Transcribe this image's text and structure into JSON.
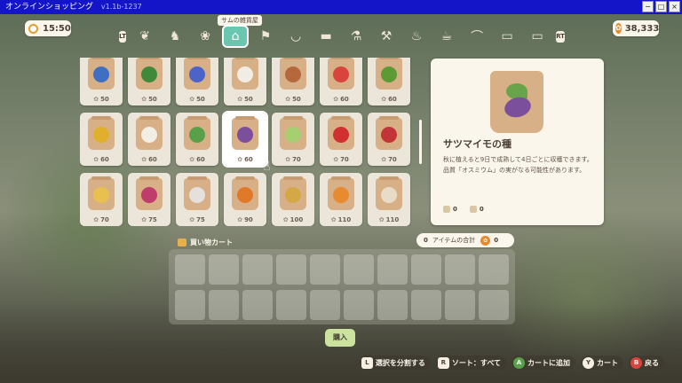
{
  "window": {
    "title": "オンラインショッピング",
    "version": "v1.1b-1237",
    "btn_min": "−",
    "btn_max": "□",
    "btn_close": "×"
  },
  "hud": {
    "time": "15:50",
    "money": "38,333"
  },
  "categories": {
    "lt": "LT",
    "rt": "RT",
    "tooltip": "サムの雑貨屋",
    "icons": [
      "feather-icon",
      "cat-icon",
      "seed-bag-icon",
      "shop-icon",
      "farm-icon",
      "bowl-icon",
      "anvil-icon",
      "flask-icon",
      "hammer-icon",
      "pot-icon",
      "cup-icon",
      "hanger-icon",
      "sofa-icon",
      "sofa2-icon"
    ],
    "active_index": 3
  },
  "products": [
    {
      "price": "50",
      "color": "#3f6fc2"
    },
    {
      "price": "50",
      "color": "#3f8a3a"
    },
    {
      "price": "50",
      "color": "#4c64c8"
    },
    {
      "price": "50",
      "color": "#f1ede4"
    },
    {
      "price": "50",
      "color": "#b4683c"
    },
    {
      "price": "60",
      "color": "#d9443c"
    },
    {
      "price": "60",
      "color": "#5b9a34"
    },
    {
      "price": "60",
      "color": "#e0b02c"
    },
    {
      "price": "60",
      "color": "#f2eee4"
    },
    {
      "price": "60",
      "color": "#5aa04a"
    },
    {
      "price": "60",
      "color": "#7c4f9c",
      "selected": true
    },
    {
      "price": "70",
      "color": "#a6d070"
    },
    {
      "price": "70",
      "color": "#d03030"
    },
    {
      "price": "70",
      "color": "#c23438"
    },
    {
      "price": "70",
      "color": "#e8c050"
    },
    {
      "price": "75",
      "color": "#c03c6c"
    },
    {
      "price": "75",
      "color": "#e4e0dc"
    },
    {
      "price": "90",
      "color": "#e07a28"
    },
    {
      "price": "100",
      "color": "#d4a844"
    },
    {
      "price": "110",
      "color": "#e88b30"
    },
    {
      "price": "110",
      "color": "#e8dcc8"
    }
  ],
  "detail": {
    "name": "サツマイモの種",
    "description": "秋に植えると9日で成熟して4日ごとに収穫できます。品質「オスミウム」の実がなる可能性があります。",
    "stat1": "0",
    "stat2": "0"
  },
  "cart": {
    "title": "買い物カート",
    "item_count": "0",
    "total_label": "アイテムの合計",
    "total_value": "0",
    "buy_label": "購入"
  },
  "hints": [
    {
      "key": "L",
      "label": "選択を分割する",
      "style": "sq"
    },
    {
      "key": "R",
      "label": "ソート：すべて",
      "style": "sq"
    },
    {
      "key": "A",
      "label": "カートに追加",
      "style": "gr"
    },
    {
      "key": "Y",
      "label": "カート",
      "style": "wh"
    },
    {
      "key": "B",
      "label": "戻る",
      "style": "rd"
    }
  ]
}
